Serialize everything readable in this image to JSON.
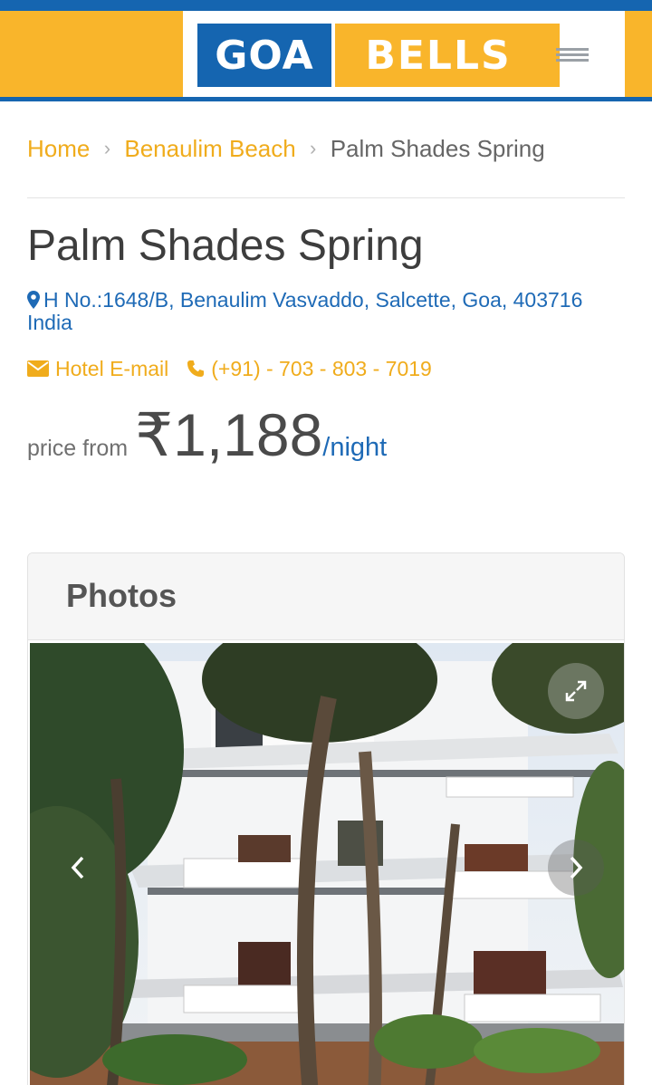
{
  "header": {
    "logo_left": "GOA",
    "logo_right": "BELLS",
    "menu_icon": "hamburger-menu-icon"
  },
  "breadcrumb": {
    "items": [
      "Home",
      "Benaulim Beach"
    ],
    "current": "Palm Shades Spring",
    "separator": "›"
  },
  "hotel": {
    "name": "Palm Shades Spring",
    "address": "H No.:1648/B, Benaulim Vasvaddo, Salcette, Goa, 403716 India",
    "email_label": "Hotel E-mail",
    "phone": "(+91) - 703 - 803 - 7019",
    "price_prefix": "price from",
    "price": "₹1,188",
    "price_unit": "/night"
  },
  "photos": {
    "title": "Photos",
    "prev_icon": "chevron-left-icon",
    "next_icon": "chevron-right-icon",
    "expand_icon": "expand-icon"
  },
  "colors": {
    "brand_blue": "#1565b0",
    "brand_yellow": "#f9b52b",
    "link_yellow": "#f0ac1c",
    "text_blue": "#1e6ab6"
  }
}
